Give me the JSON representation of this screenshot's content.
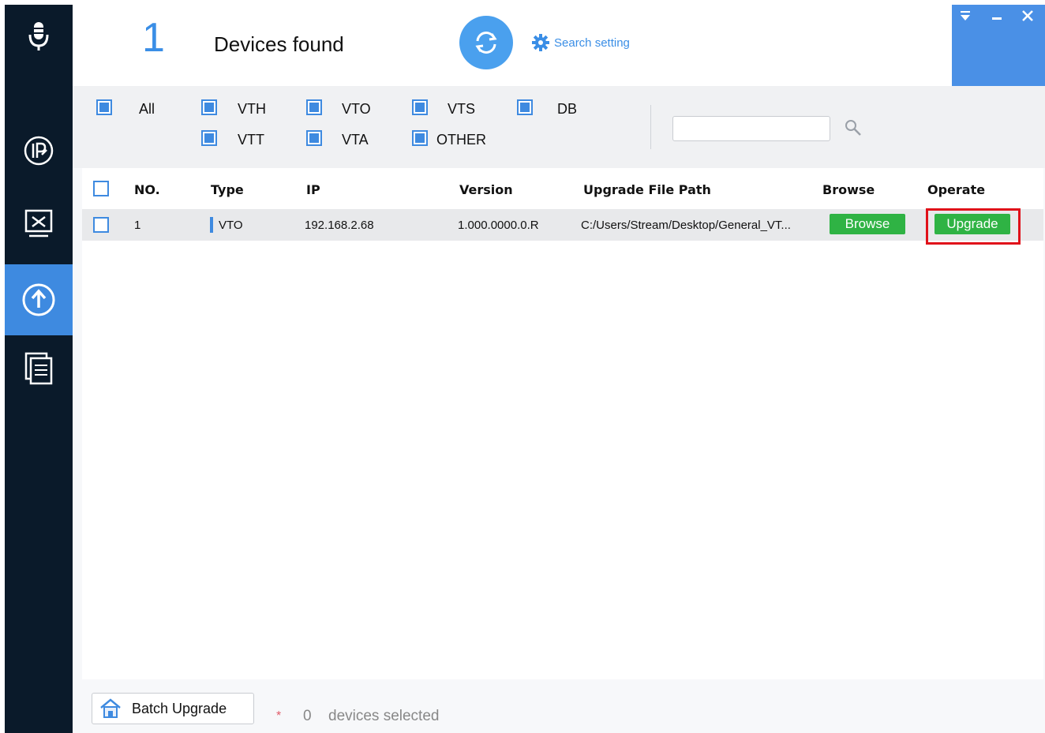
{
  "header": {
    "count": "1",
    "title": "Devices found",
    "search_setting": "Search setting",
    "refresh_icon": "refresh-icon",
    "window_controls": [
      "menu-down-icon",
      "minimize-icon",
      "close-icon"
    ]
  },
  "sidebar": {
    "items": [
      {
        "icon": "microphone-icon"
      },
      {
        "icon": "ip-icon"
      },
      {
        "icon": "tools-icon"
      },
      {
        "icon": "upgrade-icon",
        "active": true
      },
      {
        "icon": "document-icon"
      }
    ]
  },
  "filters": {
    "all": "All",
    "vth": "VTH",
    "vto": "VTO",
    "vts": "VTS",
    "db": "DB",
    "vtt": "VTT",
    "vta": "VTA",
    "other": "OTHER",
    "search_placeholder": ""
  },
  "table": {
    "headers": {
      "no": "NO.",
      "type": "Type",
      "ip": "IP",
      "version": "Version",
      "path": "Upgrade File Path",
      "browse": "Browse",
      "operate": "Operate"
    },
    "rows": [
      {
        "no": "1",
        "type": "VTO",
        "ip": "192.168.2.68",
        "version": "1.000.0000.0.R",
        "path": "C:/Users/Stream/Desktop/General_VT...",
        "browse_label": "Browse",
        "upgrade_label": "Upgrade"
      }
    ]
  },
  "footer": {
    "batch_label": "Batch Upgrade",
    "star": "*",
    "selected_count": "0",
    "selected_text": "devices selected"
  },
  "colors": {
    "accent": "#3e8ae0",
    "sidebar": "#0a1a2a",
    "green": "#2fb344",
    "highlight": "#e0111a"
  }
}
